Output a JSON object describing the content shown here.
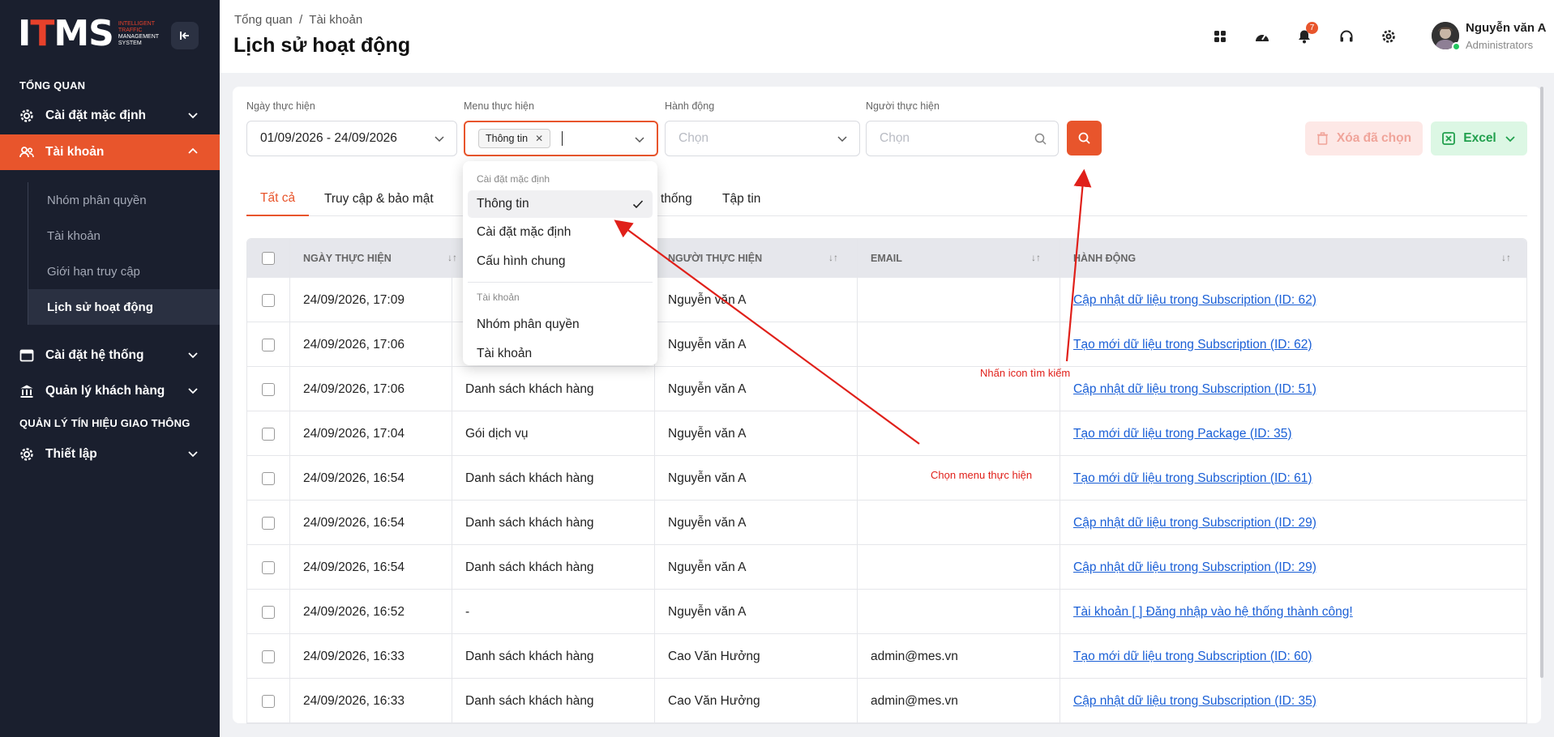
{
  "sidebar": {
    "logo": {
      "prefix": "I",
      "accent": "T",
      "suffix": "MS",
      "tagline_accent": "INTELLIGENT TRAFFIC",
      "tagline": "MANAGEMENT SYSTEM"
    },
    "section_overview": "TỔNG QUAN",
    "items": [
      {
        "label": "Cài đặt mặc định",
        "icon": "gear-icon"
      },
      {
        "label": "Tài khoản",
        "icon": "users-icon"
      }
    ],
    "sub_items": [
      {
        "label": "Nhóm phân quyền"
      },
      {
        "label": "Tài khoản"
      },
      {
        "label": "Giới hạn truy cập"
      },
      {
        "label": "Lịch sử hoạt động"
      }
    ],
    "items2": [
      {
        "label": "Cài đặt hệ thống",
        "icon": "window-icon"
      },
      {
        "label": "Quản lý khách hàng",
        "icon": "bank-icon"
      }
    ],
    "section_signals": "QUẢN LÝ TÍN HIỆU GIAO THÔNG",
    "items3": [
      {
        "label": "Thiết lập",
        "icon": "gear-icon"
      }
    ]
  },
  "header": {
    "breadcrumb": "Tổng quan  /  Tài khoản",
    "title": "Lịch sử hoạt động",
    "notification_count": "7",
    "user_name": "Nguyễn văn A",
    "user_role": "Administrators"
  },
  "filters": {
    "date_label": "Ngày thực hiện",
    "date_value": "01/09/2026 - 24/09/2026",
    "menu_label": "Menu thực hiện",
    "menu_tag": "Thông tin",
    "action_label": "Hành động",
    "action_placeholder": "Chọn",
    "user_label": "Người thực hiện",
    "user_placeholder": "Chọn",
    "delete_label": "Xóa đã chọn",
    "excel_label": "Excel"
  },
  "tabs": [
    {
      "label": "Tất cả"
    },
    {
      "label": "Truy cập & bảo mật"
    },
    {
      "label": "thống"
    },
    {
      "label": "Tập tin"
    }
  ],
  "table": {
    "headers": {
      "date": "NGÀY THỰC HIỆN",
      "user": "NGƯỜI THỰC HIỆN",
      "email": "EMAIL",
      "action": "HÀNH ĐỘNG"
    },
    "rows": [
      {
        "date": "24/09/2026, 17:09",
        "menu": "",
        "user": "Nguyễn văn A",
        "email": "",
        "action": "Cập nhật dữ liệu trong Subscription (ID: 62)"
      },
      {
        "date": "24/09/2026, 17:06",
        "menu": "",
        "user": "Nguyễn văn A",
        "email": "",
        "action": "Tạo mới dữ liệu trong Subscription (ID: 62)"
      },
      {
        "date": "24/09/2026, 17:06",
        "menu": "Danh sách khách hàng",
        "user": "Nguyễn văn A",
        "email": "",
        "action": "Cập nhật dữ liệu trong Subscription (ID: 51)"
      },
      {
        "date": "24/09/2026, 17:04",
        "menu": "Gói dịch vụ",
        "user": "Nguyễn văn A",
        "email": "",
        "action": "Tạo mới dữ liệu trong Package (ID: 35)"
      },
      {
        "date": "24/09/2026, 16:54",
        "menu": "Danh sách khách hàng",
        "user": "Nguyễn văn A",
        "email": "",
        "action": "Tạo mới dữ liệu trong Subscription (ID: 61)"
      },
      {
        "date": "24/09/2026, 16:54",
        "menu": "Danh sách khách hàng",
        "user": "Nguyễn văn A",
        "email": "",
        "action": "Cập nhật dữ liệu trong Subscription (ID: 29)"
      },
      {
        "date": "24/09/2026, 16:54",
        "menu": "Danh sách khách hàng",
        "user": "Nguyễn văn A",
        "email": "",
        "action": "Cập nhật dữ liệu trong Subscription (ID: 29)"
      },
      {
        "date": "24/09/2026, 16:52",
        "menu": "-",
        "user": "Nguyễn văn A",
        "email": "",
        "action": "Tài khoản [ ] Đăng nhập vào hệ thống thành công!"
      },
      {
        "date": "24/09/2026, 16:33",
        "menu": "Danh sách khách hàng",
        "user": "Cao Văn Hưởng",
        "email": "admin@mes.vn",
        "action": "Tạo mới dữ liệu trong Subscription (ID: 60)"
      },
      {
        "date": "24/09/2026, 16:33",
        "menu": "Danh sách khách hàng",
        "user": "Cao Văn Hưởng",
        "email": "admin@mes.vn",
        "action": "Cập nhật dữ liệu trong Subscription (ID: 35)"
      }
    ]
  },
  "dropdown": {
    "group1": "Cài đặt mặc định",
    "options1": [
      {
        "label": "Thông tin",
        "selected": true
      },
      {
        "label": "Cài đặt mặc định",
        "selected": false
      },
      {
        "label": "Cấu hình chung",
        "selected": false
      }
    ],
    "group2": "Tài khoản",
    "options2": [
      {
        "label": "Nhóm phân quyền",
        "selected": false
      },
      {
        "label": "Tài khoản",
        "selected": false
      }
    ]
  },
  "annotations": {
    "search_hint": "Nhấn icon tìm kiếm",
    "menu_hint": "Chọn menu thực hiện"
  },
  "colors": {
    "accent": "#e8552c",
    "sidebar": "#1a1f2e",
    "link": "#1a5fd6",
    "annotation": "#e0201a"
  }
}
